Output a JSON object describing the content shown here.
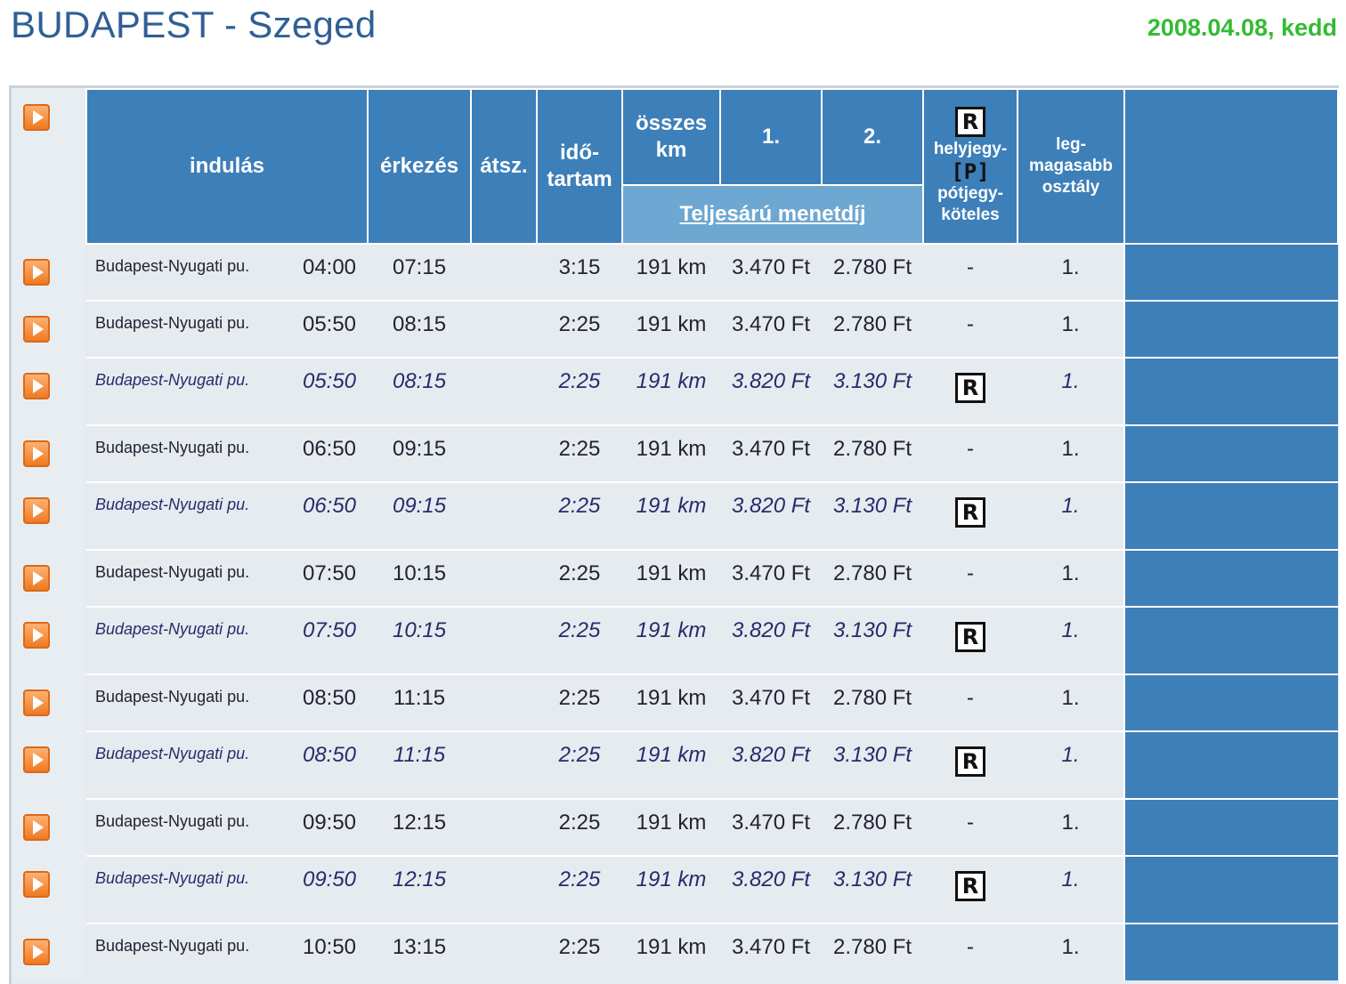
{
  "route_title": "BUDAPEST - Szeged",
  "date": "2008.04.08, kedd",
  "header": {
    "indulas": "indulás",
    "erkezes": "érkezés",
    "atsz": "átsz.",
    "idotartam_1": "idő-",
    "idotartam_2": "tartam",
    "osszes_1": "összes",
    "osszes_2": "km",
    "class1": "1.",
    "class2": "2.",
    "teljesaru": "Teljesárú menetdíj",
    "r_symbol": "R",
    "helyjegy": "helyjegy-",
    "p_symbol": "[P]",
    "potjegy": "pótjegy-",
    "koteles": "köteles",
    "leg_1": "leg-",
    "leg_2": "magasabb",
    "leg_3": "osztály"
  },
  "rows": [
    {
      "station": "Budapest-Nyugati pu.",
      "dep": "04:00",
      "arr": "07:15",
      "dur": "3:15",
      "km": "191 km",
      "price1": "3.470 Ft",
      "price2": "2.780 Ft",
      "reserve": "-",
      "highest": "1.",
      "italic": false
    },
    {
      "station": "Budapest-Nyugati pu.",
      "dep": "05:50",
      "arr": "08:15",
      "dur": "2:25",
      "km": "191 km",
      "price1": "3.470 Ft",
      "price2": "2.780 Ft",
      "reserve": "-",
      "highest": "1.",
      "italic": false
    },
    {
      "station": "Budapest-Nyugati pu.",
      "dep": "05:50",
      "arr": "08:15",
      "dur": "2:25",
      "km": "191 km",
      "price1": "3.820 Ft",
      "price2": "3.130 Ft",
      "reserve": "R",
      "highest": "1.",
      "italic": true
    },
    {
      "station": "Budapest-Nyugati pu.",
      "dep": "06:50",
      "arr": "09:15",
      "dur": "2:25",
      "km": "191 km",
      "price1": "3.470 Ft",
      "price2": "2.780 Ft",
      "reserve": "-",
      "highest": "1.",
      "italic": false
    },
    {
      "station": "Budapest-Nyugati pu.",
      "dep": "06:50",
      "arr": "09:15",
      "dur": "2:25",
      "km": "191 km",
      "price1": "3.820 Ft",
      "price2": "3.130 Ft",
      "reserve": "R",
      "highest": "1.",
      "italic": true
    },
    {
      "station": "Budapest-Nyugati pu.",
      "dep": "07:50",
      "arr": "10:15",
      "dur": "2:25",
      "km": "191 km",
      "price1": "3.470 Ft",
      "price2": "2.780 Ft",
      "reserve": "-",
      "highest": "1.",
      "italic": false
    },
    {
      "station": "Budapest-Nyugati pu.",
      "dep": "07:50",
      "arr": "10:15",
      "dur": "2:25",
      "km": "191 km",
      "price1": "3.820 Ft",
      "price2": "3.130 Ft",
      "reserve": "R",
      "highest": "1.",
      "italic": true
    },
    {
      "station": "Budapest-Nyugati pu.",
      "dep": "08:50",
      "arr": "11:15",
      "dur": "2:25",
      "km": "191 km",
      "price1": "3.470 Ft",
      "price2": "2.780 Ft",
      "reserve": "-",
      "highest": "1.",
      "italic": false
    },
    {
      "station": "Budapest-Nyugati pu.",
      "dep": "08:50",
      "arr": "11:15",
      "dur": "2:25",
      "km": "191 km",
      "price1": "3.820 Ft",
      "price2": "3.130 Ft",
      "reserve": "R",
      "highest": "1.",
      "italic": true
    },
    {
      "station": "Budapest-Nyugati pu.",
      "dep": "09:50",
      "arr": "12:15",
      "dur": "2:25",
      "km": "191 km",
      "price1": "3.470 Ft",
      "price2": "2.780 Ft",
      "reserve": "-",
      "highest": "1.",
      "italic": false
    },
    {
      "station": "Budapest-Nyugati pu.",
      "dep": "09:50",
      "arr": "12:15",
      "dur": "2:25",
      "km": "191 km",
      "price1": "3.820 Ft",
      "price2": "3.130 Ft",
      "reserve": "R",
      "highest": "1.",
      "italic": true
    },
    {
      "station": "Budapest-Nyugati pu.",
      "dep": "10:50",
      "arr": "13:15",
      "dur": "2:25",
      "km": "191 km",
      "price1": "3.470 Ft",
      "price2": "2.780 Ft",
      "reserve": "-",
      "highest": "1.",
      "italic": false
    }
  ],
  "colors": {
    "header_blue": "#3d7fb9",
    "subheader_blue": "#6da7d2",
    "title_blue": "#2f5f95",
    "date_green": "#33bb33",
    "play_orange": "#ee7a22"
  }
}
